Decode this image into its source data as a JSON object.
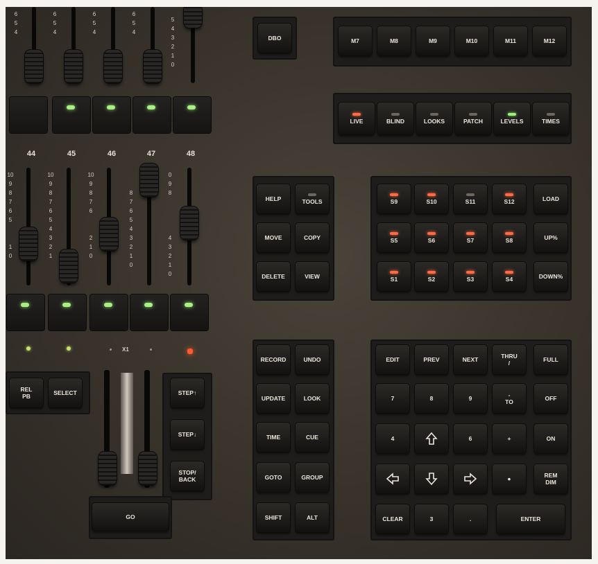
{
  "top_scale": "6\n5\n4",
  "scale5": "5\n4\n3\n2\n1\n0",
  "fader_numbers": [
    "44",
    "45",
    "46",
    "47",
    "48"
  ],
  "scales": [
    "10\n9\n8\n7\n6\n5\n\n\n1\n0",
    "10\n9\n8\n7\n6\n5\n4\n3\n2\n1",
    "10\n9\n8\n7\n6\n\n\n2\n1\n0",
    "\n\n8\n7\n6\n5\n4\n3\n2\n1\n0",
    "0\n9\n8\n\n\n\n\n4\n3\n2\n1\n0"
  ],
  "x1_label": "X1",
  "keys": {
    "dbo": "DBO",
    "macros": [
      "M7",
      "M8",
      "M9",
      "M10",
      "M11",
      "M12"
    ],
    "modes": [
      "LIVE",
      "BLIND",
      "LOOKS",
      "PATCH",
      "LEVELS",
      "TIMES"
    ],
    "mode_leds": [
      "red",
      "off",
      "off",
      "off",
      "green",
      "off"
    ],
    "help": "HELP",
    "tools": "TOOLS",
    "move": "MOVE",
    "copy": "COPY",
    "delete": "DELETE",
    "view": "VIEW",
    "softkeys": [
      "S9",
      "S10",
      "S11",
      "S12",
      "S5",
      "S6",
      "S7",
      "S8",
      "S1",
      "S2",
      "S3",
      "S4"
    ],
    "softkey_leds": [
      "red",
      "red",
      "off",
      "red",
      "red",
      "red",
      "red",
      "red",
      "red",
      "red",
      "red",
      "red"
    ],
    "load": "LOAD",
    "up": "UP%",
    "down": "DOWN%",
    "rel_pb": "REL\nPB",
    "select": "SELECT",
    "step_up": "STEP↑",
    "step_down": "STEP↓",
    "stop_back": "STOP/\nBACK",
    "go": "GO",
    "record": "RECORD",
    "undo": "UNDO",
    "update": "UPDATE",
    "look": "LOOK",
    "time": "TIME",
    "cue": "CUE",
    "goto": "GOTO",
    "group": "GROUP",
    "shift": "SHIFT",
    "alt": "ALT",
    "edit": "EDIT",
    "prev": "PREV",
    "next": "NEXT",
    "thru": "THRU\n/",
    "full": "FULL",
    "k7": "7",
    "k8": "8",
    "k9": "9",
    "to": "-\nTO",
    "off": "OFF",
    "k4": "4",
    "k6": "6",
    "plus": "+",
    "on": "ON",
    "dot": "●",
    "rem_dim": "REM\nDIM",
    "clear": "CLEAR",
    "k3": "3",
    "period": ".",
    "enter": "ENTER"
  }
}
